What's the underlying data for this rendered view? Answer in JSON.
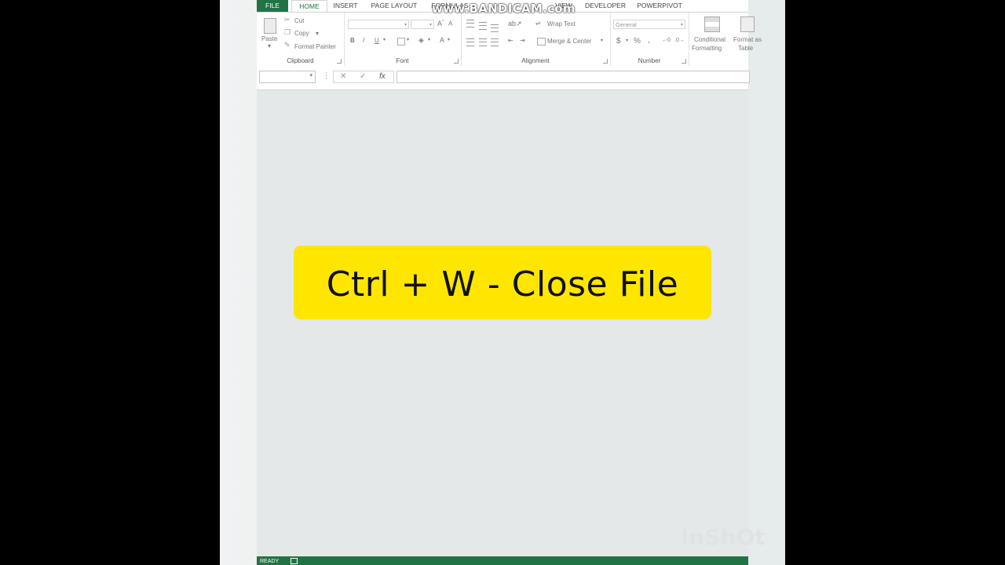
{
  "tabs": {
    "file": "FILE",
    "home": "HOME",
    "insert": "INSERT",
    "page_layout": "PAGE LAYOUT",
    "formulas": "FORMULAS",
    "data": "DATA",
    "review": "REVIEW",
    "view": "VIEW",
    "developer": "DEVELOPER",
    "powerpivot": "POWERPIVOT"
  },
  "clipboard": {
    "paste": "Paste",
    "cut": "Cut",
    "copy": "Copy",
    "format_painter": "Format Painter",
    "label": "Clipboard"
  },
  "font": {
    "label": "Font",
    "bold": "B",
    "italic": "I",
    "underline": "U"
  },
  "alignment": {
    "wrap_text": "Wrap Text",
    "merge_center": "Merge & Center",
    "label": "Alignment"
  },
  "number": {
    "format": "General",
    "currency": "$",
    "percent": "%",
    "comma": ",",
    "label": "Number"
  },
  "styles": {
    "conditional_1": "Conditional",
    "conditional_2": "Formatting",
    "format_table_1": "Format as",
    "format_table_2": "Table"
  },
  "formula_bar": {
    "fx": "fx",
    "cancel": "✕",
    "enter": "✓"
  },
  "status": {
    "ready": "READY"
  },
  "overlay": {
    "text": "Ctrl + W - Close File"
  },
  "watermarks": {
    "top": "www.BANDICAM.com",
    "bottom": "InShOt"
  },
  "colors": {
    "excel_green": "#217346",
    "banner": "#ffe600"
  }
}
